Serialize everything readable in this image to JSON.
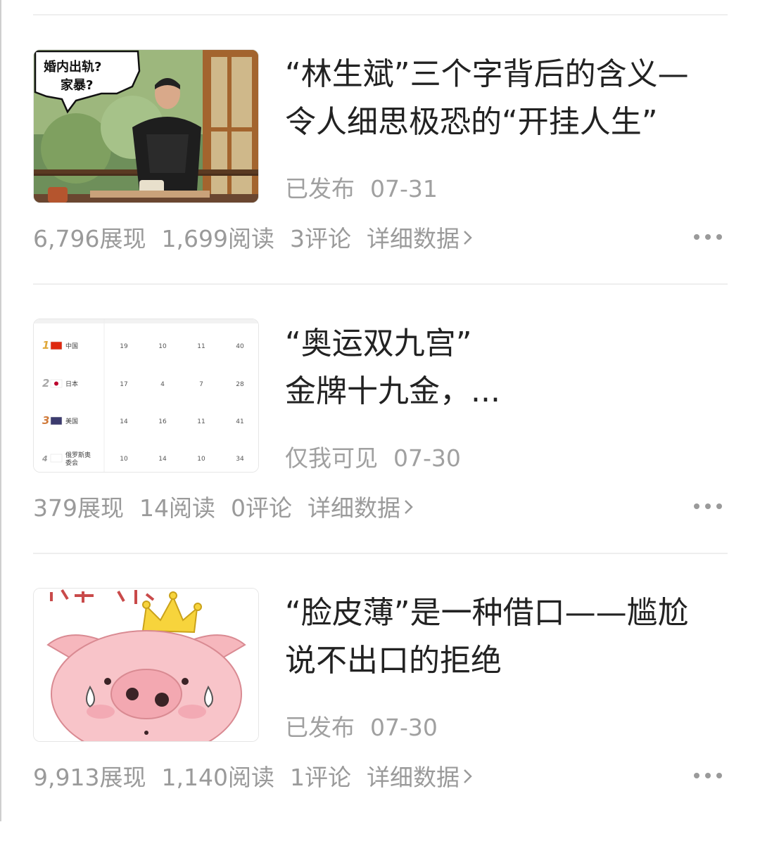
{
  "articles": [
    {
      "title_line1": "“林生斌”三个字背后的含义—",
      "title_line2": "令人细思极恐的“开挂人生”",
      "status": "已发布",
      "date": "07-31",
      "impressions": "6,796展现",
      "reads": "1,699阅读",
      "comments": "3评论",
      "detail_label": "详细数据",
      "thumb_caption_1": "婚内出轨?",
      "thumb_caption_2": "家暴?"
    },
    {
      "title_line1": "“奥运双九宫”",
      "title_line2": "金牌十九金，...",
      "status": "仅我可见",
      "date": "07-30",
      "impressions": "379展现",
      "reads": "14阅读",
      "comments": "0评论",
      "detail_label": "详细数据",
      "medal_table": [
        {
          "rank": "1",
          "country": "中国",
          "gold": "19",
          "silver": "10",
          "bronze": "11",
          "total": "40"
        },
        {
          "rank": "2",
          "country": "日本",
          "gold": "17",
          "silver": "4",
          "bronze": "7",
          "total": "28"
        },
        {
          "rank": "3",
          "country": "美国",
          "gold": "14",
          "silver": "16",
          "bronze": "11",
          "total": "41"
        },
        {
          "rank": "4",
          "country": "俄罗斯奥委会",
          "gold": "10",
          "silver": "14",
          "bronze": "10",
          "total": "34"
        }
      ]
    },
    {
      "title_line1": "“脸皮薄”是一种借口——尴尬",
      "title_line2": "说不出口的拒绝",
      "status": "已发布",
      "date": "07-30",
      "impressions": "9,913展现",
      "reads": "1,140阅读",
      "comments": "1评论",
      "detail_label": "详细数据"
    }
  ],
  "colors": {
    "title": "#222222",
    "meta": "#a0a0a0",
    "divider": "#eeeeee"
  }
}
